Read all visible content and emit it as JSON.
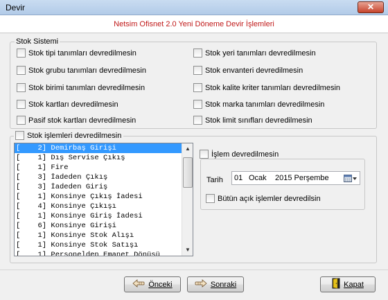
{
  "window": {
    "title": "Devir",
    "close_label": "✕"
  },
  "header": {
    "text": "Netsim Ofisnet 2.0 Yeni Döneme Devir İşlemleri"
  },
  "stok_sistemi": {
    "label": "Stok Sistemi",
    "left": [
      "Stok tipi tanımları devredilmesin",
      "Stok grubu tanımları devredilmesin",
      "Stok birimi tanımları devredilmesin",
      "Stok kartları devredilmesin",
      "Pasif stok kartları devredilmesin"
    ],
    "right": [
      "Stok yeri tanımları devredilmesin",
      "Stok envanteri devredilmesin",
      "Stok kalite kriter tanımları devredilmesin",
      "Stok marka tanımları devredilmesin",
      "Stok limit sınıfları devredilmesin"
    ]
  },
  "stok_islemleri": {
    "label": "Stok işlemleri devredilmesin",
    "items": [
      "[    2] Demirbaş Girişi",
      "[    1] Dış Servise Çıkış",
      "[    1] Fire",
      "[    3] İadeden Çıkış",
      "[    3] İadeden Giriş",
      "[    1] Konsinye Çıkış İadesi",
      "[    4] Konsinye Çıkışı",
      "[    1] Konsinye Giriş İadesi",
      "[    6] Konsinye Girişi",
      "[    1] Konsinye Stok Alışı",
      "[    1] Konsinye Stok Satışı",
      "[    1] Personelden Emanet Dönüşü"
    ],
    "selected_index": 0
  },
  "islem": {
    "label": "İşlem devredilmesin",
    "tarih_label": "Tarih",
    "date": {
      "day": "01",
      "month": "Ocak",
      "year_day": "2015 Perşembe"
    },
    "bütün_label": "Bütün açık işlemler devredilsin"
  },
  "buttons": {
    "prev": "Önceki",
    "next": "Sonraki",
    "close": "Kapat"
  },
  "colors": {
    "header_text": "#c01818",
    "selection": "#3399ff"
  }
}
